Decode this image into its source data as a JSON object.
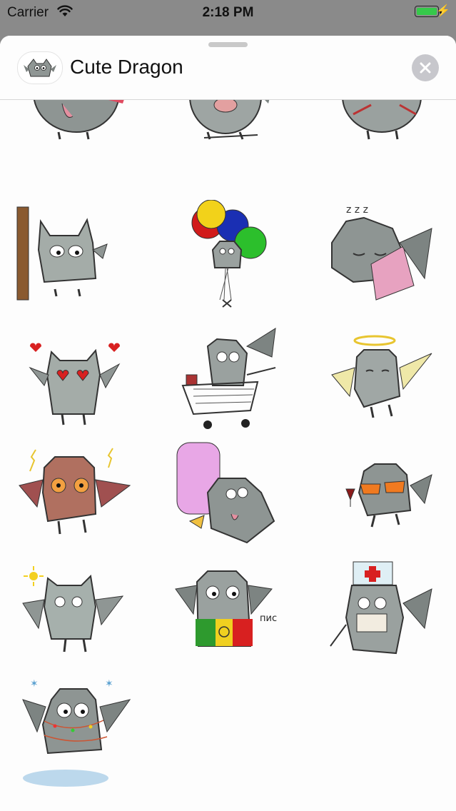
{
  "status_bar": {
    "carrier": "Carrier",
    "time": "2:18 PM",
    "battery_level": 1.0
  },
  "header": {
    "app_name": "Cute Dragon",
    "app_icon": "dragon-icon",
    "close_icon": "close-icon"
  },
  "stickers": [
    {
      "id": "tongue-dragon",
      "icon": "dragon-tongue-sticker"
    },
    {
      "id": "laughing-dragon",
      "icon": "dragon-laughing-sticker"
    },
    {
      "id": "sword-dragon",
      "icon": "dragon-sword-sticker"
    },
    {
      "id": "shy-dragon",
      "icon": "dragon-shy-sticker"
    },
    {
      "id": "balloon-dragon",
      "icon": "dragon-balloons-sticker"
    },
    {
      "id": "sleepy-dragon",
      "icon": "dragon-sleeping-sticker"
    },
    {
      "id": "love-dragon",
      "icon": "dragon-heart-eyes-sticker"
    },
    {
      "id": "shopping-dragon",
      "icon": "dragon-shopping-cart-sticker"
    },
    {
      "id": "angel-dragon",
      "icon": "dragon-angel-sticker"
    },
    {
      "id": "angry-dragon",
      "icon": "dragon-angry-sticker"
    },
    {
      "id": "icecream-dragon",
      "icon": "dragon-ice-cream-sticker"
    },
    {
      "id": "cool-dragon",
      "icon": "dragon-sunglasses-sticker"
    },
    {
      "id": "sunny-dragon",
      "icon": "dragon-sun-sticker"
    },
    {
      "id": "peace-dragon",
      "icon": "dragon-peace-shirt-sticker",
      "caption": "пис"
    },
    {
      "id": "doctor-dragon",
      "icon": "dragon-doctor-sticker"
    },
    {
      "id": "festive-dragon",
      "icon": "dragon-christmas-lights-sticker"
    }
  ]
}
